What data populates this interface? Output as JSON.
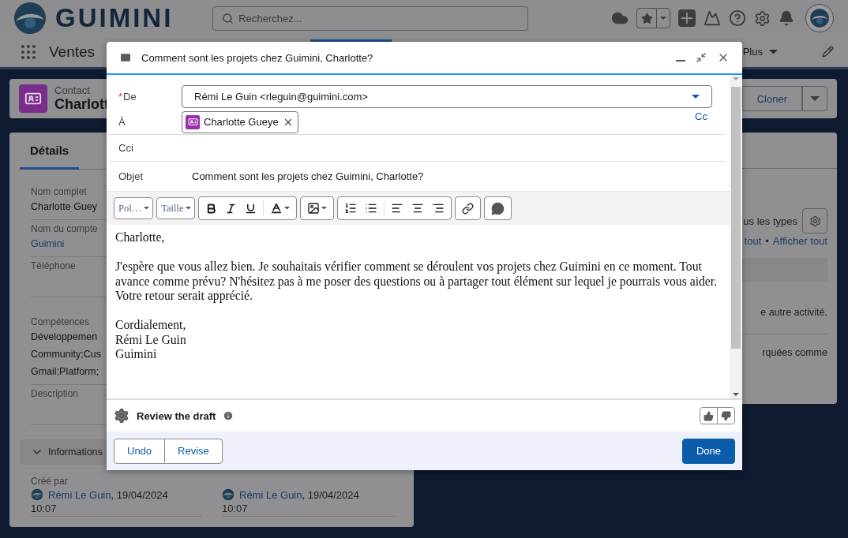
{
  "header": {
    "brand": "GUIMINI",
    "search": {
      "placeholder": "Recherchez..."
    }
  },
  "nav": {
    "app_name": "Ventes",
    "more": "Plus"
  },
  "record": {
    "type": "Contact",
    "name": "Charlott",
    "actions": [
      {
        "label": "Cloner"
      }
    ]
  },
  "details": {
    "tabs": [
      {
        "label": "Détails",
        "selected": true
      }
    ],
    "fields": [
      {
        "label": "Nom complet",
        "kind": "text",
        "values": [
          "Charlotte Guey"
        ]
      },
      {
        "label": "Nom du compte",
        "kind": "link",
        "values": [
          "Guimini"
        ]
      },
      {
        "label": "Téléphone"
      },
      {
        "label": "Compétences",
        "kind": "text",
        "values": [
          "Développemen",
          "Community;Cus",
          "Gmail;Platform;"
        ]
      },
      {
        "label": "Description"
      }
    ],
    "section": {
      "title": "Informations",
      "expanded": true
    },
    "created": [
      {
        "label": "Créé par",
        "user": "Rémi Le Guin",
        "date": ", 19/04/2024",
        "time": "10:07"
      },
      {
        "user": "Rémi Le Guin",
        "date": ", 19/04/2024",
        "time": "10:07"
      }
    ]
  },
  "activity": {
    "filter_text": "us les types",
    "links": [
      {
        "label": "tout"
      },
      {
        "label": "Afficher tout"
      }
    ],
    "separator": "•",
    "messages": [
      "e autre activité.",
      "rquées comme"
    ]
  },
  "composer": {
    "title": "Comment sont les projets chez Guimini, Charlotte?",
    "from": {
      "label": "De",
      "required_mark": "*",
      "value": "Rémi Le Guin <rleguin@guimini.com>"
    },
    "to": {
      "label": "À",
      "recipients": [
        {
          "name": "Charlotte Gueye"
        }
      ],
      "cc": "Cc"
    },
    "bcc": {
      "label": "Cci"
    },
    "subject": {
      "label": "Objet",
      "value": "Comment sont les projets chez Guimini, Charlotte?"
    },
    "toolbar": {
      "font": "Pol…",
      "size": "Taille"
    },
    "body": [
      {
        "lines": [
          "Charlotte,"
        ]
      },
      {
        "lines": [
          "J'espère que vous allez bien. Je souhaitais vérifier comment se déroulent vos projets chez Guimini en ce moment. Tout avance comme prévu? N'hésitez pas à me poser des questions ou à partager tout élément sur lequel je pourrais vous aider. Votre retour serait apprécié."
        ]
      },
      {
        "lines": [
          "Cordialement,",
          "Rémi Le Guin",
          "Guimini"
        ]
      }
    ],
    "review": {
      "title": "Review the draft"
    },
    "actions": [
      {
        "label": "Undo",
        "kind": "secondary"
      },
      {
        "label": "Revise",
        "kind": "secondary"
      },
      {
        "label": "Done",
        "kind": "primary"
      }
    ]
  }
}
